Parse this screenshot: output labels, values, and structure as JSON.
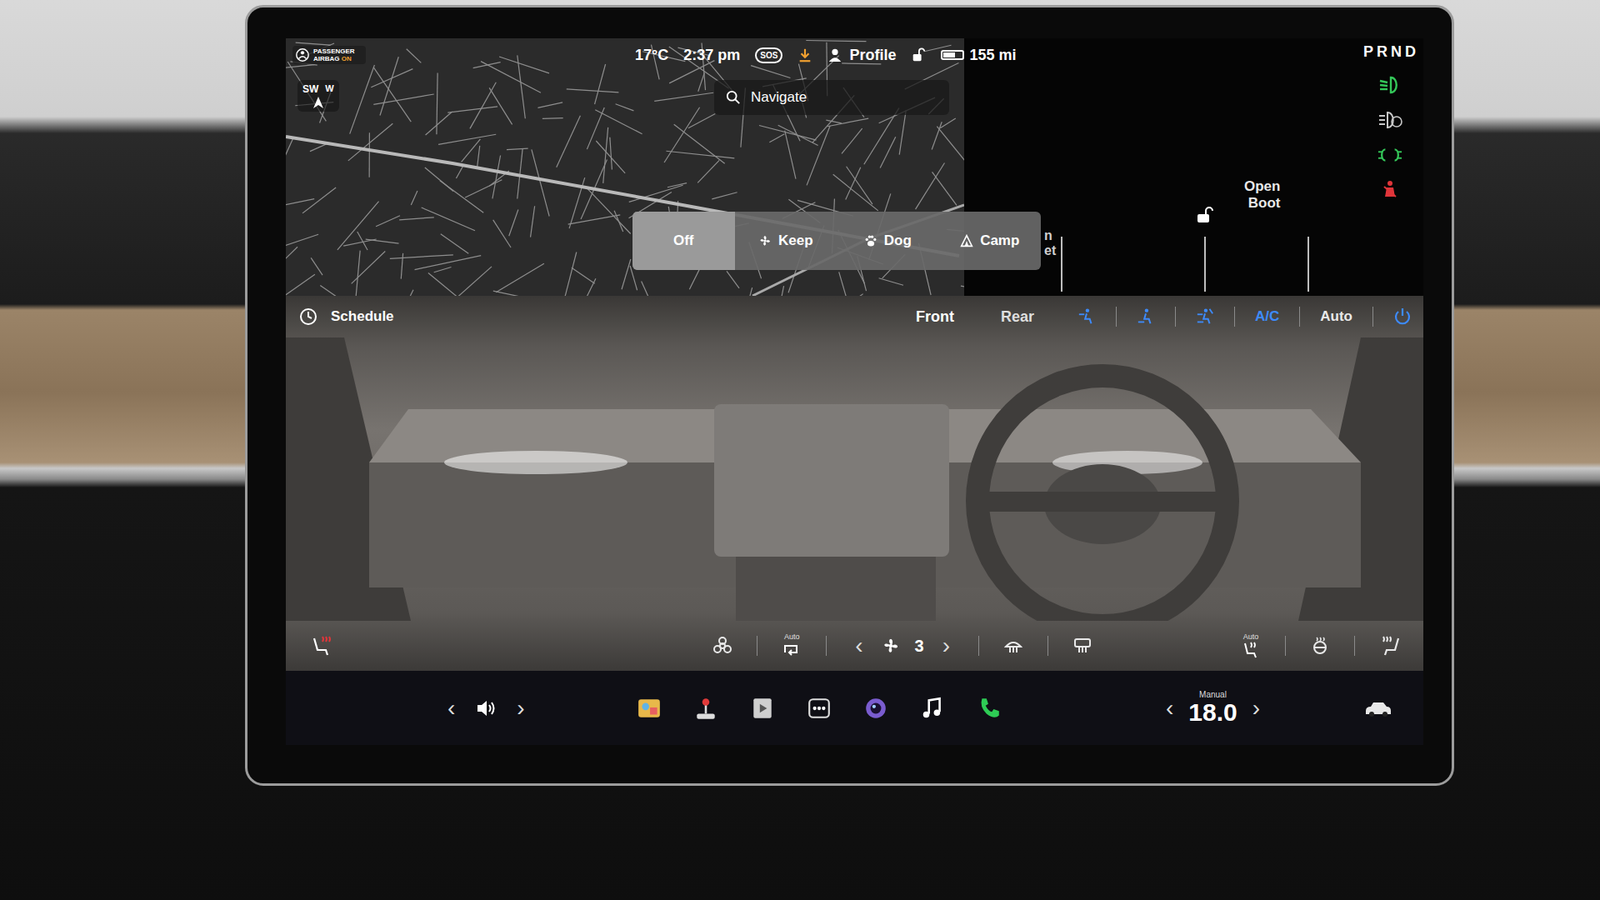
{
  "status_bar": {
    "airbag_lines": [
      "PASSENGER",
      "AIRBAG"
    ],
    "airbag_state": "ON",
    "temperature": "17°C",
    "time": "2:37 pm",
    "sos": "SOS",
    "profile": "Profile",
    "range": "155 mi",
    "battery_level": 0.6
  },
  "gear_letters": [
    "P",
    "R",
    "N",
    "D"
  ],
  "compass": {
    "primary": "SW",
    "secondary": "W"
  },
  "search": {
    "placeholder": "Navigate"
  },
  "cabin_modes": [
    {
      "label": "Off",
      "kind": "off",
      "selected": true
    },
    {
      "label": "Keep",
      "kind": "keep",
      "selected": false
    },
    {
      "label": "Dog",
      "kind": "dog",
      "selected": false
    },
    {
      "label": "Camp",
      "kind": "camp",
      "selected": false
    }
  ],
  "covered_label_lines": [
    "n",
    "et"
  ],
  "boot": {
    "lines": [
      "Open",
      "Boot"
    ]
  },
  "indicators": [
    {
      "kind": "low-beam",
      "color": "#34c759"
    },
    {
      "kind": "auto-high-beam",
      "color": "#c8c8c8"
    },
    {
      "kind": "parking-lights",
      "color": "#34c759"
    },
    {
      "kind": "seatbelt",
      "color": "#e0353a"
    }
  ],
  "climate": {
    "schedule": "Schedule",
    "zones": [
      {
        "label": "Front",
        "selected": true
      },
      {
        "label": "Rear",
        "selected": false
      }
    ],
    "airflow": [
      {
        "kind": "upper",
        "on": true
      },
      {
        "kind": "lower",
        "on": true
      },
      {
        "kind": "windscreen",
        "on": true
      }
    ],
    "ac": {
      "label": "A/C",
      "on": true
    },
    "auto": {
      "label": "Auto",
      "on": false
    },
    "power_on": true
  },
  "bottom_bar": {
    "left_seat_heater_on": true,
    "bioweapon_on": false,
    "recirculation_label": "Auto",
    "fan_speed": "3",
    "front_defrost_on": false,
    "rear_defrost_on": false,
    "auto_seat_label": "Auto",
    "wheel_heater_on": false,
    "right_seat_heater_on": false
  },
  "taskbar": {
    "temperature": "18.0",
    "temperature_mode": "Manual"
  }
}
